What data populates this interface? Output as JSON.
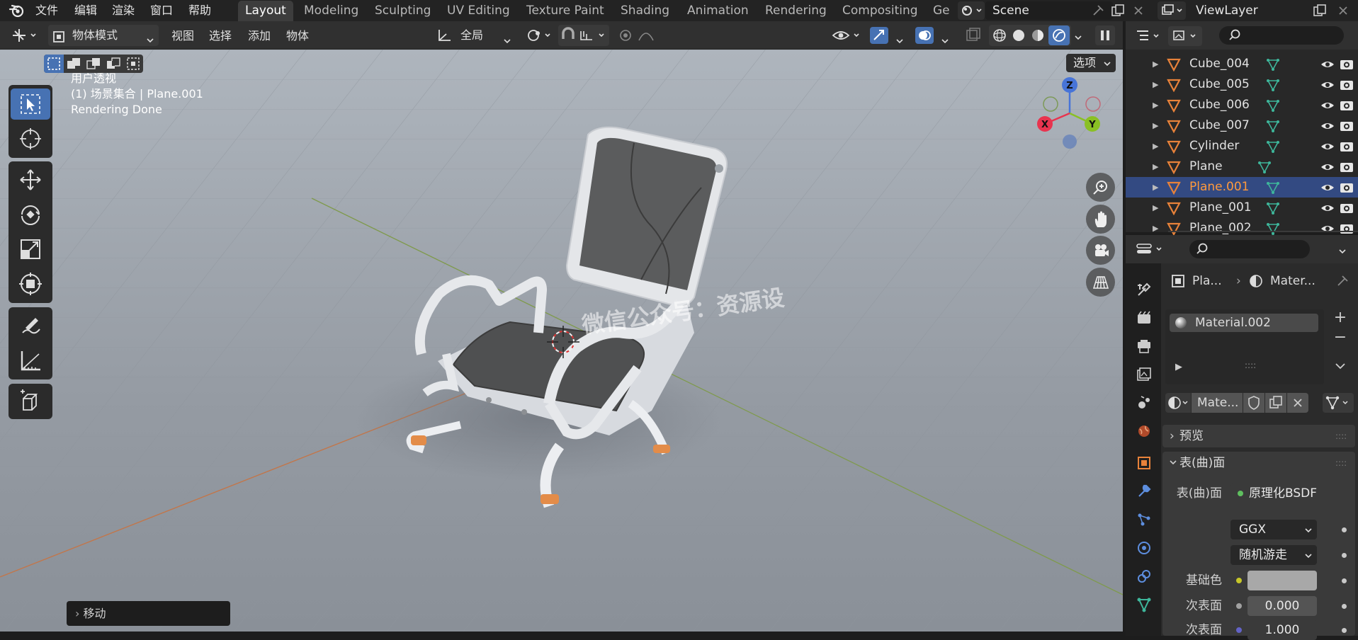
{
  "topmenu": {
    "file": "文件",
    "edit": "编辑",
    "render": "渲染",
    "window": "窗口",
    "help": "帮助"
  },
  "workspaces": [
    "Layout",
    "Modeling",
    "Sculpting",
    "UV Editing",
    "Texture Paint",
    "Shading",
    "Animation",
    "Rendering",
    "Compositing",
    "Ge"
  ],
  "scene": {
    "name": "Scene"
  },
  "view_layer": {
    "name": "ViewLayer"
  },
  "header": {
    "mode": "物体模式",
    "view": "视图",
    "select": "选择",
    "add": "添加",
    "object": "物体",
    "orientation": "全局",
    "options": "选项"
  },
  "viewport": {
    "perspective": "用户透视",
    "collection": "(1) 场景集合 | Plane.001",
    "status": "Rendering Done",
    "watermark": "微信公众号：资源设",
    "last_op": "移动"
  },
  "gizmo": {
    "z": "Z",
    "y": "Y",
    "x": "X"
  },
  "outliner": {
    "items": [
      {
        "name": "Cube_004"
      },
      {
        "name": "Cube_005"
      },
      {
        "name": "Cube_006"
      },
      {
        "name": "Cube_007"
      },
      {
        "name": "Cylinder"
      },
      {
        "name": "Plane"
      },
      {
        "name": "Plane.001",
        "selected": true
      },
      {
        "name": "Plane_001"
      },
      {
        "name": "Plane_002"
      }
    ]
  },
  "properties": {
    "breadcrumb_object": "Pla...",
    "breadcrumb_material": "Mater...",
    "slot": "Material.002",
    "material_name": "Mate...",
    "preview": "预览",
    "surface_panel": "表(曲)面",
    "surface_label": "表(曲)面",
    "surface_value": "原理化BSDF",
    "distribution": "GGX",
    "subsurface_method": "随机游走",
    "base_color_label": "基础色",
    "subsurface_label": "次表面",
    "subsurface_value": "0.000",
    "subsurface2_label": "次表面",
    "subsurface2_value": "1.000"
  },
  "colors": {
    "accent_blue": "#4772b3",
    "selected_row": "#334a82",
    "object_orange": "#e8823a",
    "axis_x": "#e8344f",
    "axis_y": "#8ac024",
    "axis_z": "#4774d8",
    "selected_text": "#ff9a3c"
  }
}
